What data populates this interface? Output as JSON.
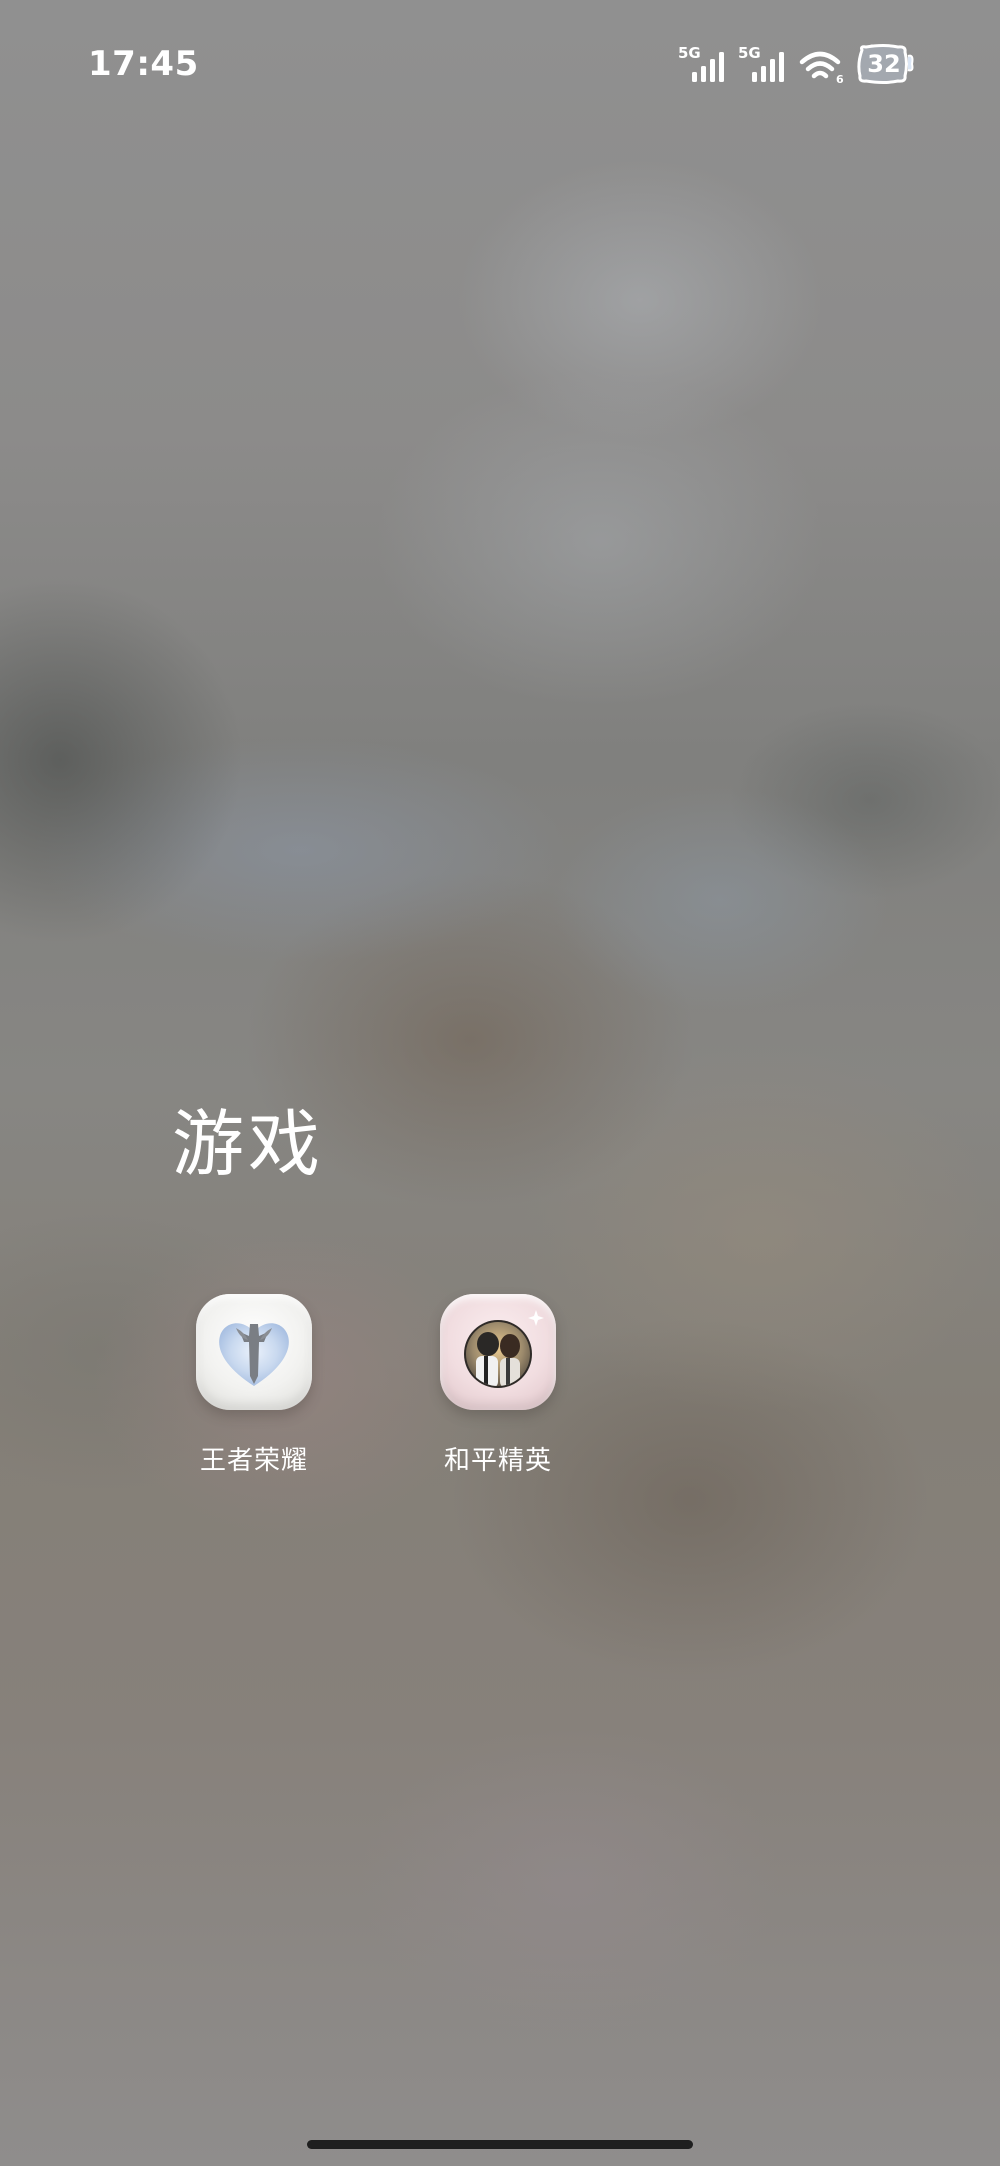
{
  "status_bar": {
    "time": "17:45",
    "signal_1_label": "5G",
    "signal_2_label": "5G",
    "wifi_icon": "wifi-icon",
    "battery_level": "32"
  },
  "folder": {
    "title": "游戏",
    "apps": [
      {
        "label": "王者荣耀",
        "icon": "honor-of-kings-icon"
      },
      {
        "label": "和平精英",
        "icon": "game-for-peace-icon"
      }
    ]
  },
  "colors": {
    "text": "#ffffff",
    "home_indicator": "#1f1f1f"
  }
}
